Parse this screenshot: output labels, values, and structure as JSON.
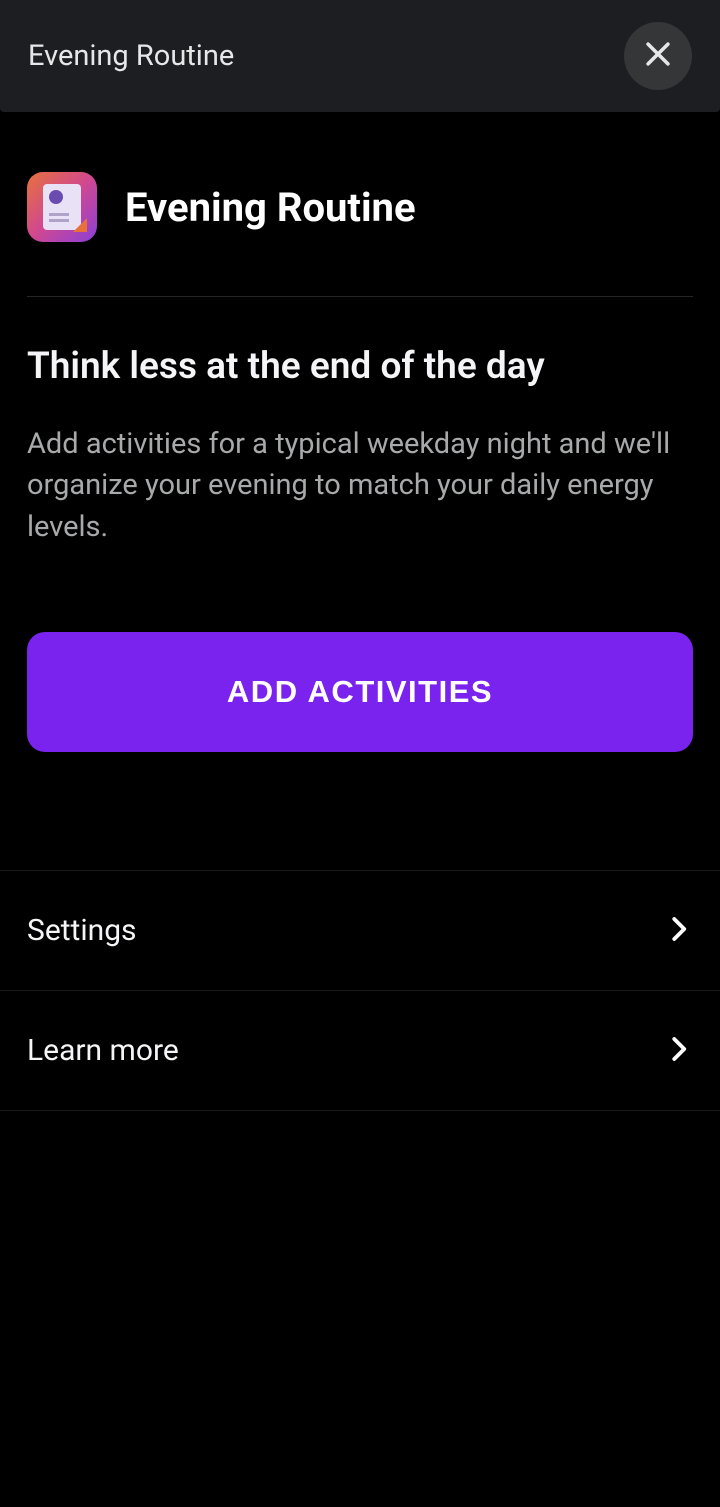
{
  "header": {
    "title": "Evening Routine"
  },
  "page": {
    "title": "Evening Routine",
    "heading": "Think less at the end of the day",
    "body": "Add activities for a typical weekday night and we'll organize your evening to match your daily energy levels."
  },
  "actions": {
    "primary_button_label": "ADD ACTIVITIES"
  },
  "list": {
    "settings_label": "Settings",
    "learn_more_label": "Learn more"
  },
  "colors": {
    "accent": "#7a22ee",
    "background": "#000000",
    "header_background": "#1c1e21"
  }
}
